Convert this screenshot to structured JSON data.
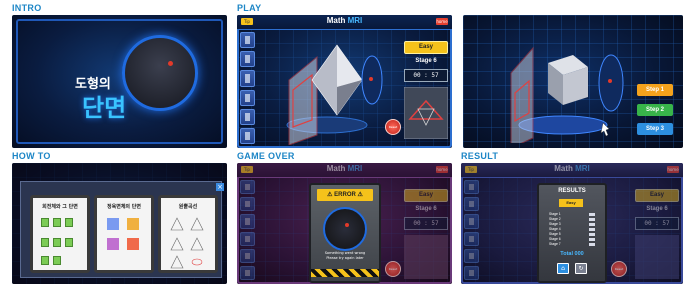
{
  "labels": {
    "intro": "INTRO",
    "play": "PLAY",
    "howto": "HOW TO",
    "gameover": "GAME OVER",
    "result": "RESULT"
  },
  "intro": {
    "title_small": "도형의",
    "title_big": "단면"
  },
  "game": {
    "title": "Math",
    "title_accent": "MRI",
    "tip": "Tip",
    "home": "home",
    "difficulty": "Easy",
    "stage": "Stage 6",
    "timer": "00 : 57",
    "reset_label": "Reset"
  },
  "steps": [
    "Step 1",
    "Step 2",
    "Step 3"
  ],
  "howto": {
    "cards": [
      "회전체와 그 단면",
      "정육면체의 단면",
      "원뿔곡선"
    ]
  },
  "gameover": {
    "badge": "ERROR",
    "line1": "Something went wrong",
    "line2": "Please try again later"
  },
  "result": {
    "header": "RESULTS",
    "difficulty": "Easy",
    "rows": [
      "Stage 1",
      "Stage 2",
      "Stage 3",
      "Stage 4",
      "Stage 5",
      "Stage 6",
      "Stage 7"
    ],
    "total": "Total 000"
  },
  "colors": {
    "accent": "#1d86c6",
    "easy": "#f5c21b",
    "step1": "#f4a21c",
    "step2": "#38b44a",
    "step3": "#2d8fe0",
    "error": "#f5c21b"
  }
}
